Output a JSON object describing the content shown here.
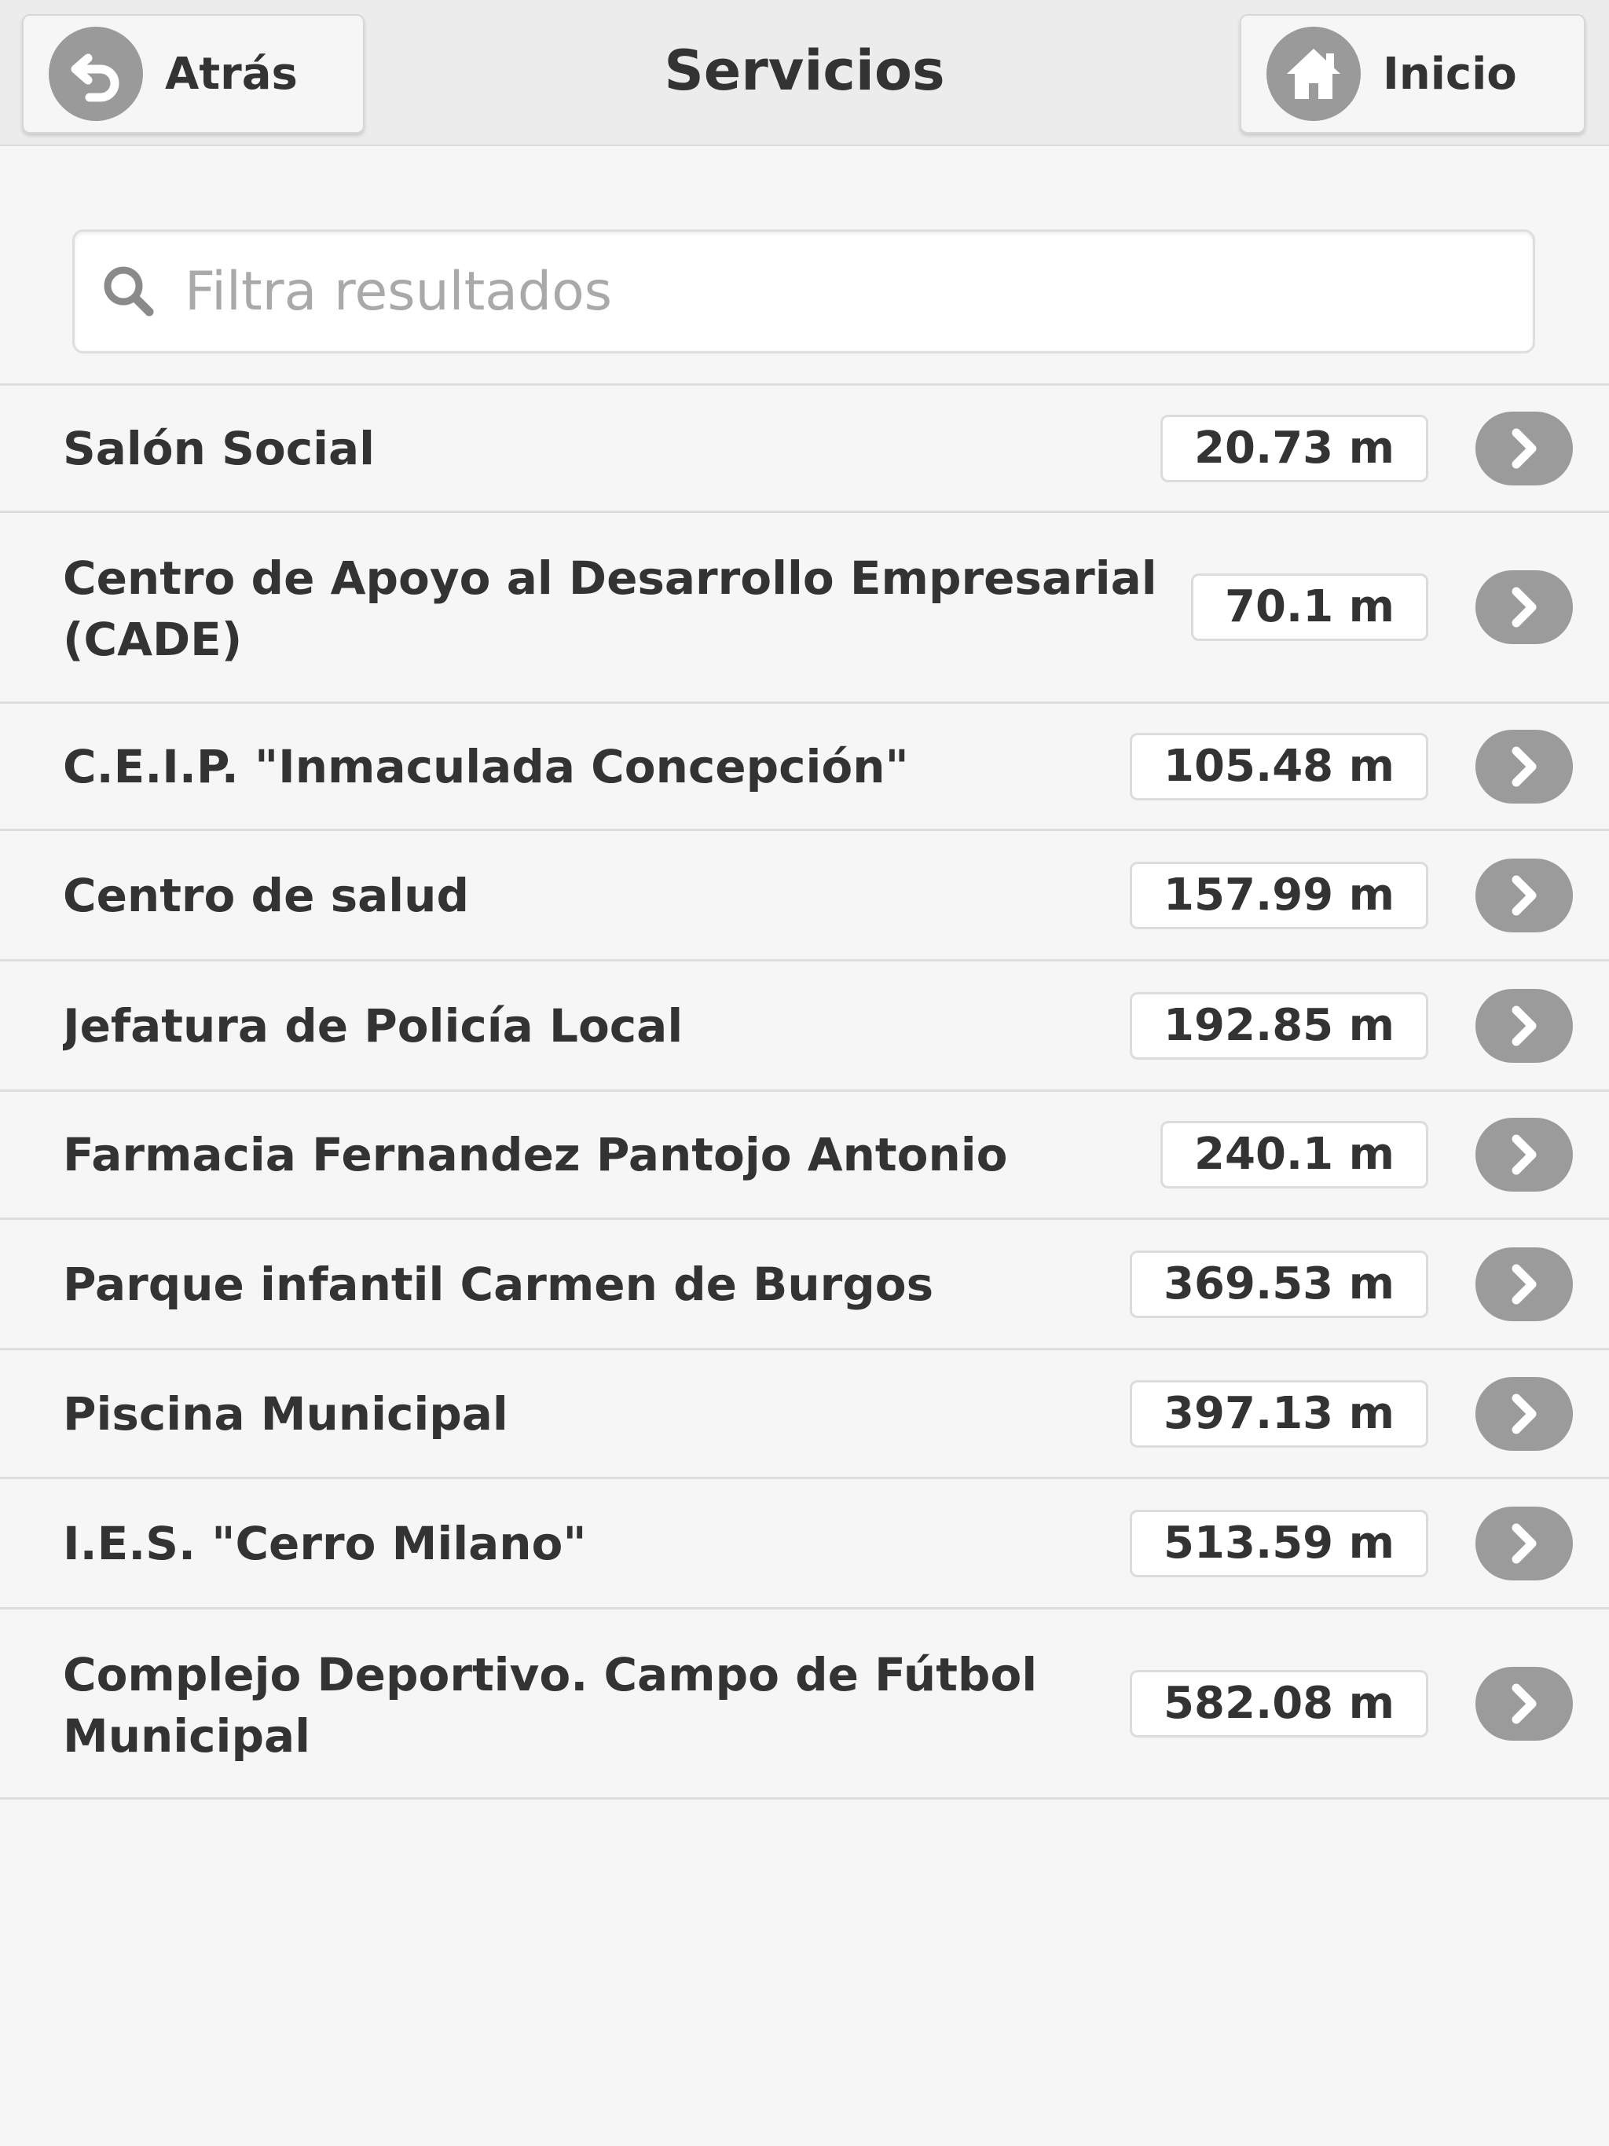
{
  "header": {
    "back_label": "Atrás",
    "title": "Servicios",
    "home_label": "Inicio"
  },
  "search": {
    "placeholder": "Filtra resultados"
  },
  "items": [
    {
      "name": "Salón Social",
      "distance": "20.73 m"
    },
    {
      "name": "Centro de Apoyo al Desarrollo Empresarial (CADE)",
      "distance": "70.1 m"
    },
    {
      "name": "C.E.I.P. \"Inmaculada Concepción\"",
      "distance": "105.48 m"
    },
    {
      "name": "Centro de salud",
      "distance": "157.99 m"
    },
    {
      "name": "Jefatura de Policía Local",
      "distance": "192.85 m"
    },
    {
      "name": "Farmacia Fernandez Pantojo Antonio",
      "distance": "240.1 m"
    },
    {
      "name": "Parque infantil Carmen de Burgos",
      "distance": "369.53 m"
    },
    {
      "name": "Piscina Municipal",
      "distance": "397.13 m"
    },
    {
      "name": "I.E.S. \"Cerro Milano\"",
      "distance": "513.59 m"
    },
    {
      "name": "Complejo Deportivo. Campo de Fútbol Municipal",
      "distance": "582.08 m"
    }
  ],
  "icons": {
    "back": "back-arrow-icon",
    "home": "home-icon",
    "search": "search-icon",
    "chevron": "chevron-right-icon"
  }
}
